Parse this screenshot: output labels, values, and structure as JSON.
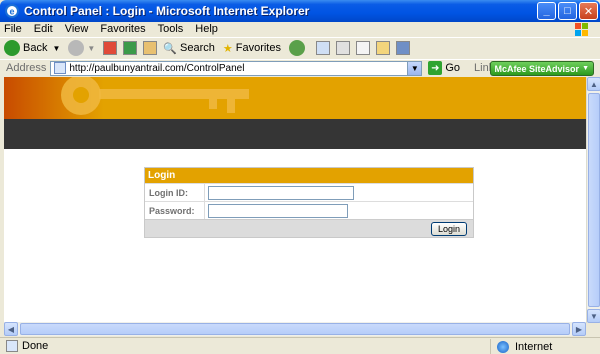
{
  "window": {
    "title": "Control Panel : Login - Microsoft Internet Explorer",
    "buttons": {
      "minimize": "_",
      "maximize": "□",
      "close": "✕"
    }
  },
  "menu": [
    "File",
    "Edit",
    "View",
    "Favorites",
    "Tools",
    "Help"
  ],
  "toolbar": {
    "back_label": "Back",
    "search_label": "Search",
    "favorites_label": "Favorites"
  },
  "address": {
    "label": "Address",
    "url": "http://paulbunyantrail.com/ControlPanel",
    "go_label": "Go",
    "links_label": "Links",
    "mcafee_label": "McAfee SiteAdvisor"
  },
  "login": {
    "header": "Login",
    "login_id_label": "Login ID:",
    "password_label": "Password:",
    "login_id_value": "",
    "password_value": "",
    "button_label": "Login"
  },
  "status": {
    "text": "Done",
    "zone": "Internet"
  },
  "colors": {
    "banner": "#e3a200",
    "dark_band": "#353535",
    "title_bar": "#0054e3"
  }
}
